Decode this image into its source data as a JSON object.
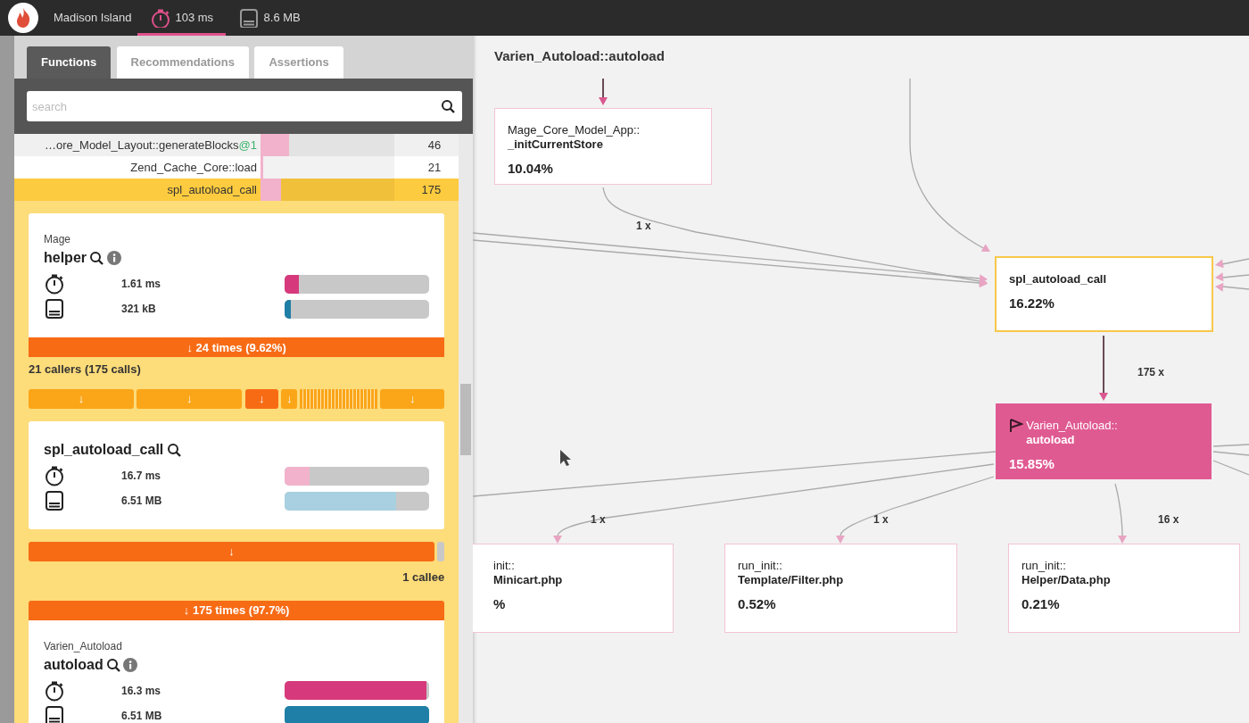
{
  "header": {
    "app_name": "Madison Island",
    "metrics": [
      {
        "kind": "time",
        "label": "103 ms",
        "selected": true
      },
      {
        "kind": "memory",
        "label": "8.6 MB",
        "selected": false
      }
    ]
  },
  "tabs": [
    {
      "label": "Functions",
      "selected": true
    },
    {
      "label": "Recommendations",
      "selected": false
    },
    {
      "label": "Assertions",
      "selected": false
    }
  ],
  "search": {
    "placeholder": "search"
  },
  "function_list": [
    {
      "name": "…ore_Model_Layout::generateBlocks",
      "suffix": "@1",
      "level": 0.21,
      "count": "46",
      "selected": false
    },
    {
      "name": "Zend_Cache_Core::load",
      "level": 0.02,
      "count": "21",
      "selected": false
    },
    {
      "name": "spl_autoload_call",
      "level": 0.15,
      "count": "175",
      "selected": true
    }
  ],
  "detail": {
    "caller_card": {
      "namespace": "Mage",
      "name": "helper",
      "info": true,
      "current": false,
      "metrics": [
        {
          "kind": "time",
          "reading": "1.61 ms",
          "level": 0.1
        },
        {
          "kind": "memory",
          "reading": "321 kB",
          "level": 0.04
        }
      ],
      "bar": "↓ 24 times (9.62%)"
    },
    "callers_summary": "21 callers (175 calls)",
    "caller_segments": [
      {
        "kind": "wide",
        "label": "↓",
        "selected": false
      },
      {
        "kind": "wide",
        "label": "↓",
        "selected": false
      },
      {
        "kind": "narrow",
        "label": "↓",
        "selected": true
      },
      {
        "kind": "cluster",
        "label": "↓",
        "selected": false
      },
      {
        "kind": "medium",
        "label": "↓",
        "selected": false
      }
    ],
    "current_card": {
      "name": "spl_autoload_call",
      "current": true,
      "metrics": [
        {
          "kind": "time",
          "reading": "16.7 ms",
          "level": 0.17
        },
        {
          "kind": "memory",
          "reading": "6.51 MB",
          "level": 0.77
        }
      ]
    },
    "callee_segments": [
      {
        "kind": "wide",
        "label": "↓",
        "selected": true
      },
      {
        "kind": "sliver",
        "selected": false
      }
    ],
    "callees_summary": "1 callee",
    "callee_card": {
      "namespace": "Varien_Autoload",
      "name": "autoload",
      "info": true,
      "current": false,
      "bar": "↓ 175 times (97.7%)",
      "metrics": [
        {
          "kind": "time",
          "reading": "16.3 ms",
          "level": 0.98
        },
        {
          "kind": "memory",
          "reading": "6.51 MB",
          "level": 1.0
        }
      ]
    }
  },
  "graph": {
    "title": "Varien_Autoload::autoload",
    "nodes": [
      {
        "kind": "caller",
        "namespace": "Mage_Core_Model_App::",
        "name": "_initCurrentStore",
        "percent": "10.04%"
      },
      {
        "kind": "selected",
        "name": "spl_autoload_call",
        "percent": "16.22%"
      },
      {
        "kind": "focus",
        "namespace": "Varien_Autoload::",
        "name": "autoload",
        "percent": "15.85%"
      },
      {
        "kind": "callee",
        "namespace": "init::",
        "name": "Minicart.php",
        "percent": "%"
      },
      {
        "kind": "callee",
        "namespace": "run_init::",
        "name": "Template/Filter.php",
        "percent": "0.52%"
      },
      {
        "kind": "callee",
        "namespace": "run_init::",
        "name": "Helper/Data.php",
        "percent": "0.21%"
      }
    ],
    "edge_labels": [
      "1 x",
      "175 x",
      "1 x",
      "1 x",
      "16 x"
    ]
  }
}
